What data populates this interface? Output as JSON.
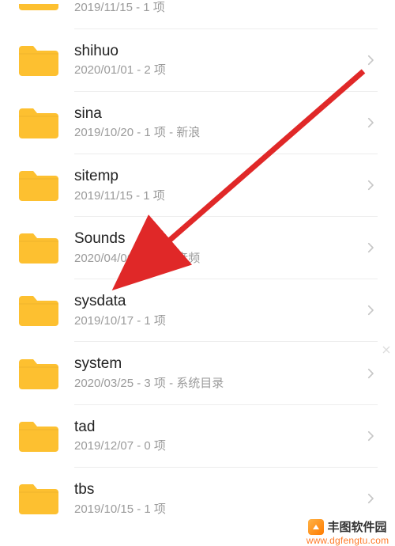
{
  "rows": [
    {
      "name": "",
      "meta": "2019/11/15 - 1 项",
      "partial_top": true
    },
    {
      "name": "shihuo",
      "meta": "2020/01/01 - 2 项"
    },
    {
      "name": "sina",
      "meta": "2019/10/20 - 1 项 - 新浪"
    },
    {
      "name": "sitemp",
      "meta": "2019/11/15 - 1 项"
    },
    {
      "name": "Sounds",
      "meta": "2020/04/06 - 4 项 - 音频"
    },
    {
      "name": "sysdata",
      "meta": "2019/10/17 - 1 项"
    },
    {
      "name": "system",
      "meta": "2020/03/25 - 3 项 - 系统目录"
    },
    {
      "name": "tad",
      "meta": "2019/12/07 - 0 项"
    },
    {
      "name": "tbs",
      "meta": "2019/10/15 - 1 项",
      "partial_bottom": true
    }
  ],
  "watermark": {
    "brand": "丰图软件园",
    "url": "www.dgfengtu.com"
  },
  "icons": {
    "folder": "folder-icon",
    "chevron": "chevron-right-icon"
  },
  "colors": {
    "folder": "#FDC030",
    "meta": "#9b9b9b",
    "title": "#222222",
    "arrow": "#E02828"
  }
}
